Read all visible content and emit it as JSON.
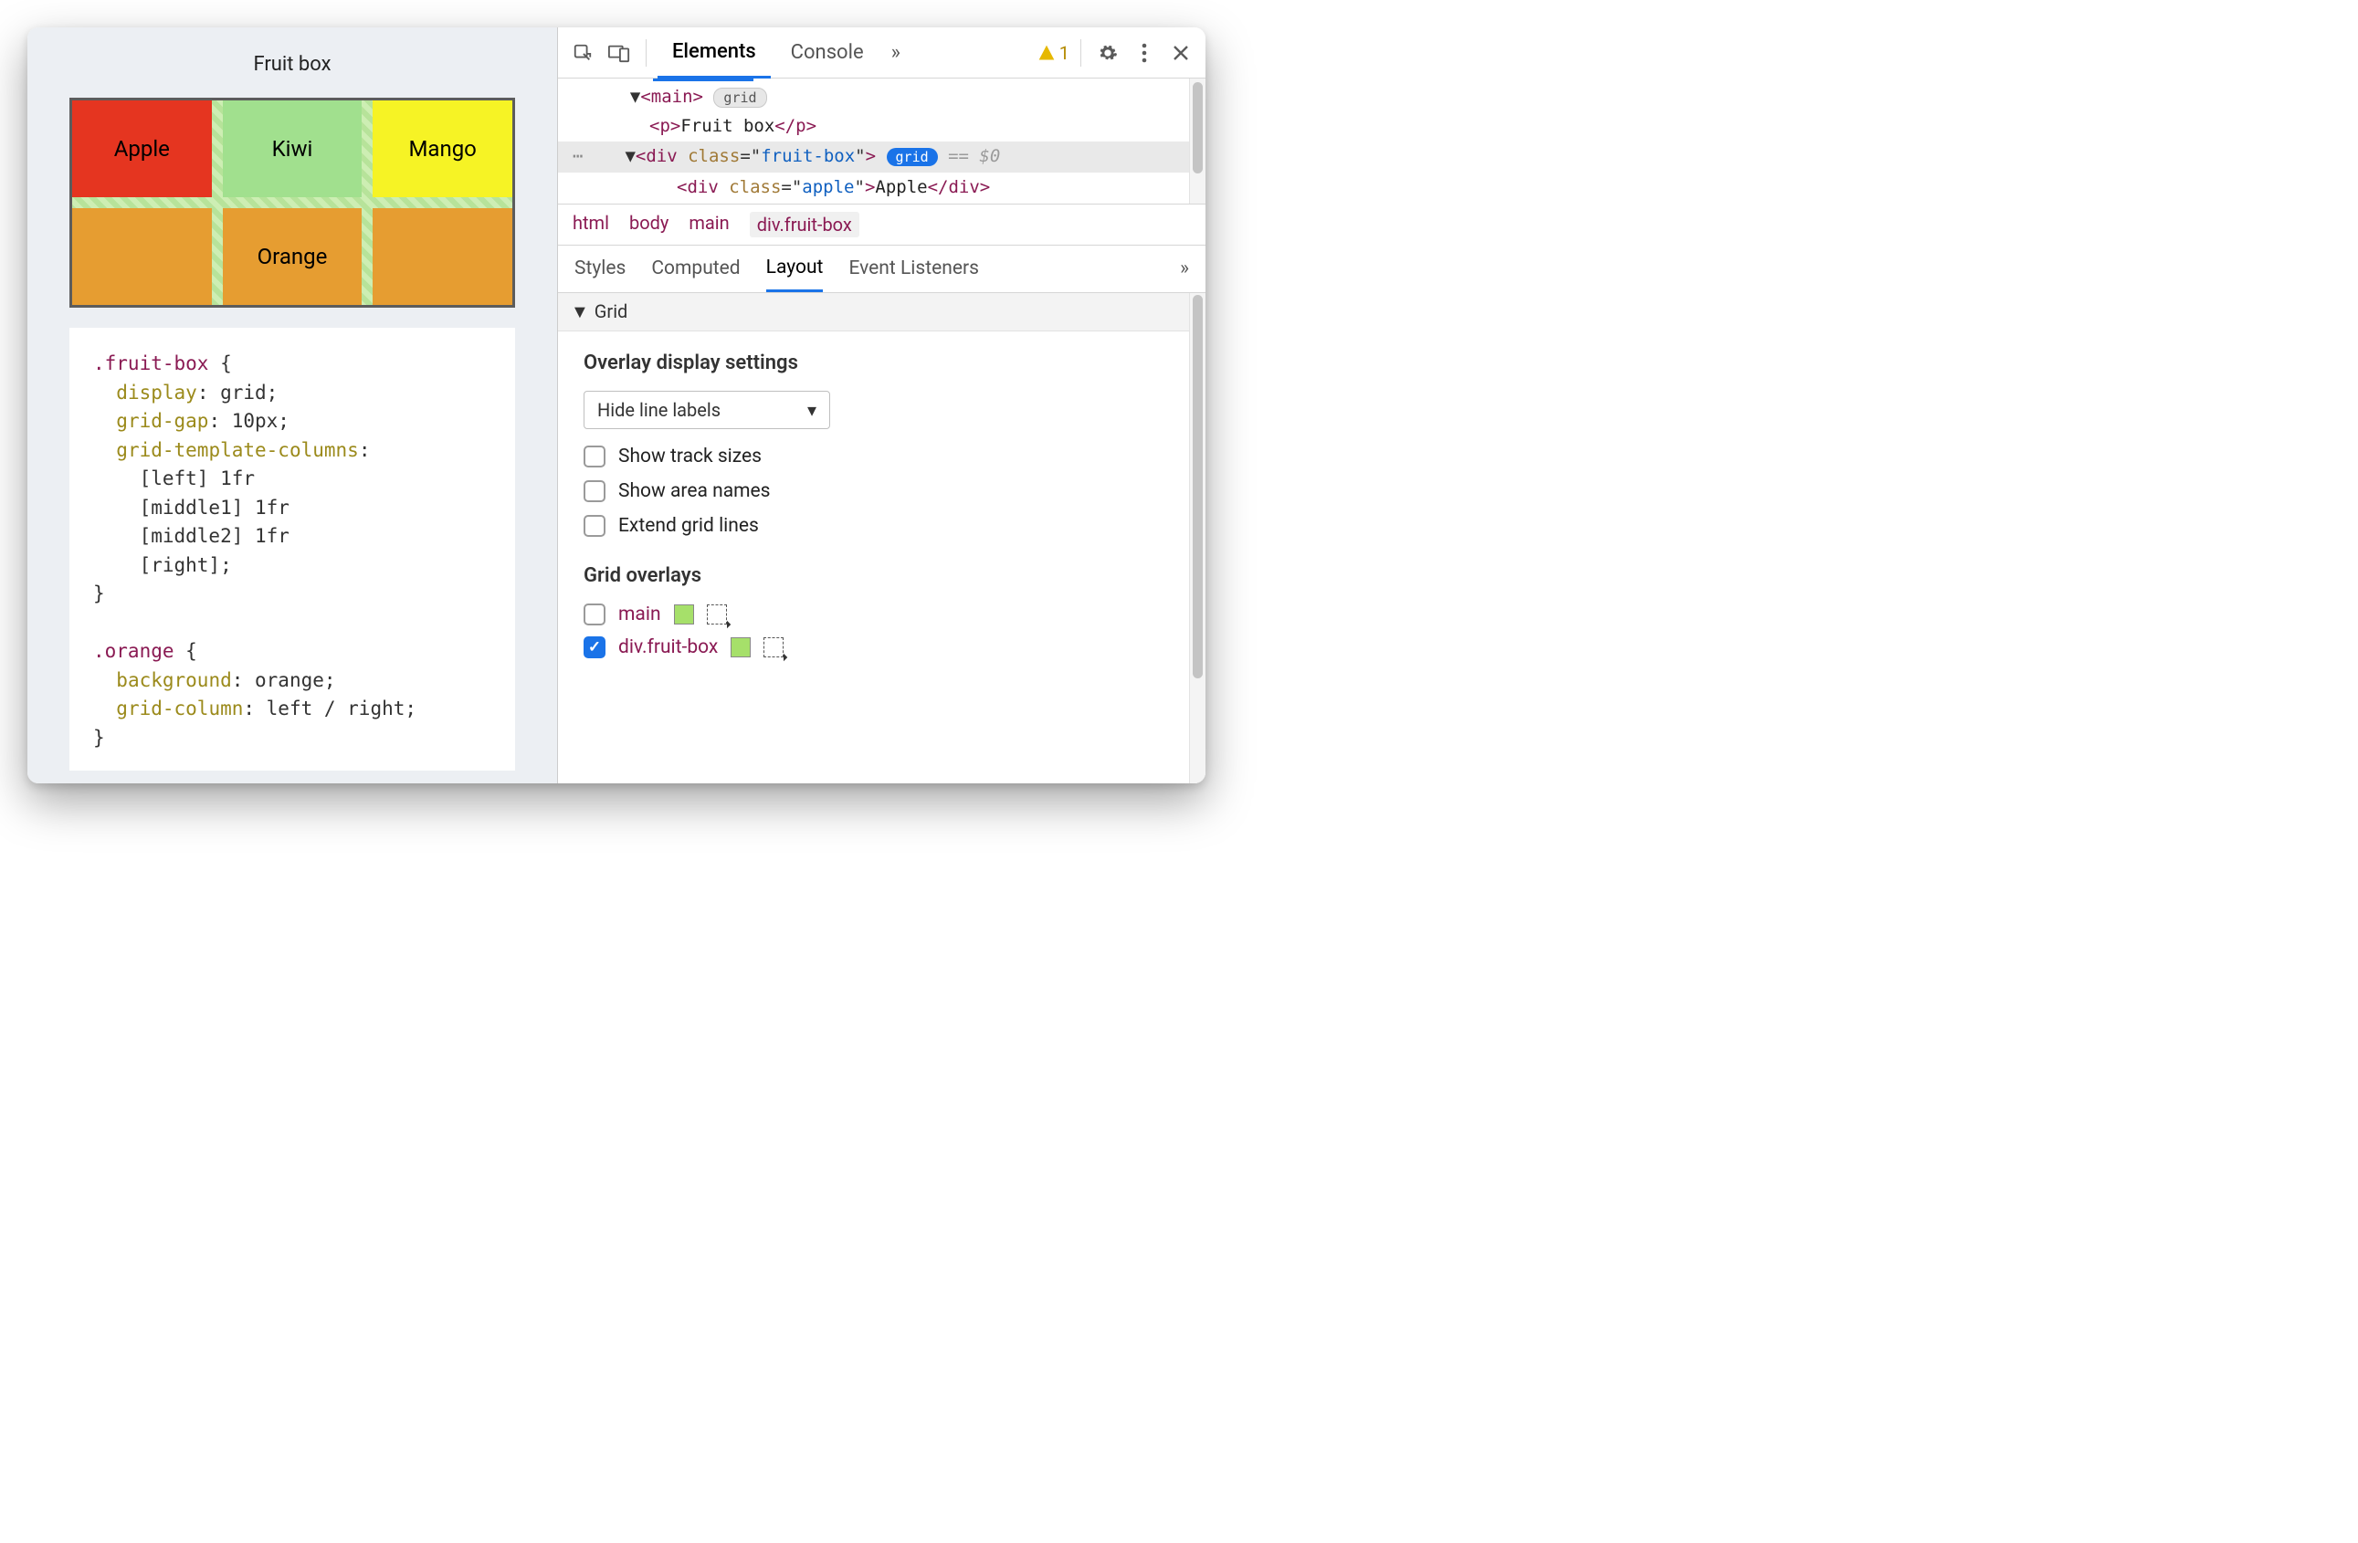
{
  "page": {
    "title": "Fruit box",
    "fruits": {
      "apple": "Apple",
      "kiwi": "Kiwi",
      "mango": "Mango",
      "orange": "Orange"
    },
    "css_text": ".fruit-box {\n  display: grid;\n  grid-gap: 10px;\n  grid-template-columns:\n    [left] 1fr\n    [middle1] 1fr\n    [middle2] 1fr\n    [right];\n}\n\n.orange {\n  background: orange;\n  grid-column: left / right;\n}"
  },
  "toolbar": {
    "tab_elements": "Elements",
    "tab_console": "Console",
    "more": "»",
    "warning_count": "1"
  },
  "dom": {
    "main_open": "<main>",
    "main_badge": "grid",
    "p_line": "<p>Fruit box</p>",
    "sel_open": "<div class=\"fruit-box\">",
    "sel_badge": "grid",
    "sel_suffix": " == $0",
    "child": "<div class=\"apple\">Apple</div>"
  },
  "crumbs": {
    "c0": "html",
    "c1": "body",
    "c2": "main",
    "c3_prefix": "div",
    "c3_suffix": ".fruit-box"
  },
  "subtabs": {
    "styles": "Styles",
    "computed": "Computed",
    "layout": "Layout",
    "events": "Event Listeners",
    "more": "»"
  },
  "layout": {
    "section": "Grid",
    "overlay_hdr": "Overlay display settings",
    "select_value": "Hide line labels",
    "cb_track": "Show track sizes",
    "cb_area": "Show area names",
    "cb_extend": "Extend grid lines",
    "overlays_hdr": "Grid overlays",
    "ov_main": "main",
    "ov_box": "div.fruit-box"
  }
}
